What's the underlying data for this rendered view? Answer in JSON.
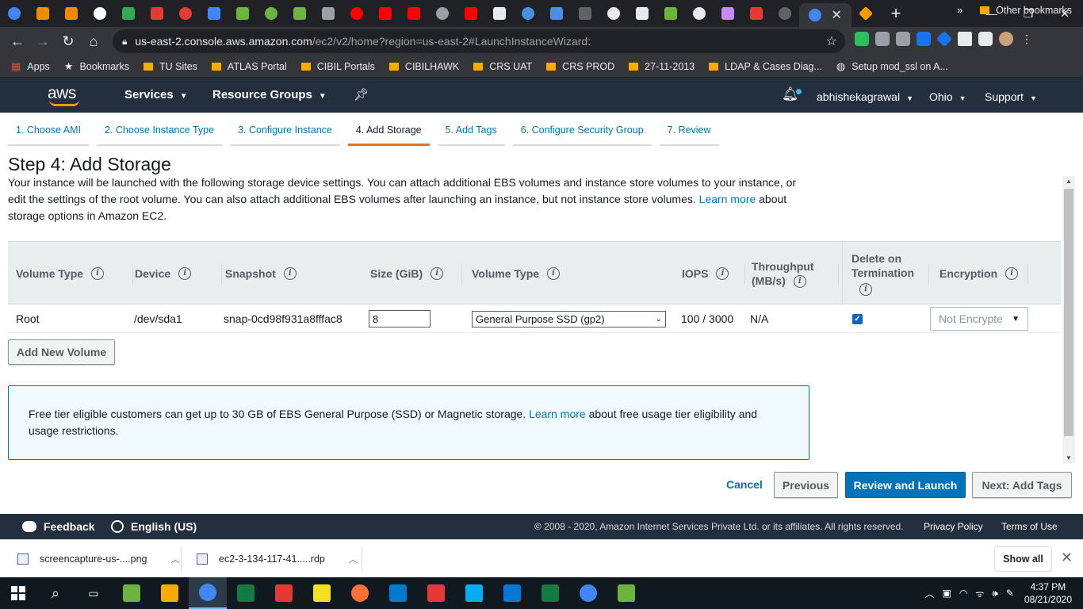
{
  "browser": {
    "url_host": "us-east-2.console.aws.amazon.com",
    "url_path": "/ec2/v2/home?region=us-east-2#LaunchInstanceWizard:",
    "tab_favicons": [
      "#4285f4",
      "#ef8b00",
      "#ef8b00",
      "#ffffff",
      "#34a853",
      "#e53935",
      "#e53935",
      "#4285f4",
      "#6db33f",
      "#6db33f",
      "#6db33f",
      "#9aa0a6",
      "#ff0000",
      "#ff0000",
      "#ff0000",
      "#9aa0a6",
      "#ff0000",
      "#e8eaed",
      "#4a90e2",
      "#4a90e2",
      "#5f6368",
      "#e8eaed",
      "#e8eaed",
      "#6db33f",
      "#e8eaed",
      "#c58af9",
      "#e53935",
      "#5f6368"
    ],
    "active_tab_close": "✕",
    "new_tab": "+",
    "bookmarks": [
      {
        "label": "Apps",
        "icon": "apps-grid-icon"
      },
      {
        "label": "Bookmarks",
        "icon": "star-icon"
      },
      {
        "label": "TU Sites",
        "icon": "folder-icon"
      },
      {
        "label": "ATLAS Portal",
        "icon": "folder-icon"
      },
      {
        "label": "CIBIL Portals",
        "icon": "folder-icon"
      },
      {
        "label": "CIBILHAWK",
        "icon": "folder-icon"
      },
      {
        "label": "CRS UAT",
        "icon": "folder-icon"
      },
      {
        "label": "CRS PROD",
        "icon": "folder-icon"
      },
      {
        "label": "27-11-2013",
        "icon": "folder-icon"
      },
      {
        "label": "LDAP & Cases Diag...",
        "icon": "folder-icon"
      },
      {
        "label": "Setup mod_ssl on A...",
        "icon": "globe-icon"
      }
    ],
    "overflow": "»",
    "other_bookmarks": "Other bookmarks"
  },
  "aws_nav": {
    "logo": "aws",
    "services": "Services",
    "resource_groups": "Resource Groups",
    "user": "abhishekagrawal",
    "region": "Ohio",
    "support": "Support"
  },
  "wizard": {
    "steps": [
      "1. Choose AMI",
      "2. Choose Instance Type",
      "3. Configure Instance",
      "4. Add Storage",
      "5. Add Tags",
      "6. Configure Security Group",
      "7. Review"
    ],
    "active_step": 3,
    "title": "Step 4: Add Storage",
    "desc_part1": "Your instance will be launched with the following storage device settings. You can attach additional EBS volumes and instance store volumes to your instance, or edit the settings of the root volume. You can also attach additional EBS volumes after launching an instance, but not instance store volumes.",
    "desc_link": "Learn more",
    "desc_part2": "about storage options in Amazon EC2."
  },
  "table": {
    "headers": {
      "volume_type": "Volume Type",
      "device": "Device",
      "snapshot": "Snapshot",
      "size": "Size (GiB)",
      "vol_type": "Volume Type",
      "iops": "IOPS",
      "throughput_1": "Throughput",
      "throughput_2": "(MB/s)",
      "delete_1": "Delete on",
      "delete_2": "Termination",
      "encryption": "Encryption"
    },
    "row": {
      "volume_type": "Root",
      "device": "/dev/sda1",
      "snapshot": "snap-0cd98f931a8fffac8",
      "size": "8",
      "vol_type": "General Purpose SSD (gp2)",
      "iops": "100 / 3000",
      "throughput": "N/A",
      "delete_on_termination": true,
      "encryption": "Not Encrypte"
    }
  },
  "add_volume": "Add New Volume",
  "free_tier": {
    "part1": "Free tier eligible customers can get up to 30 GB of EBS General Purpose (SSD) or Magnetic storage.",
    "link": "Learn more",
    "part2": "about free usage tier eligibility and usage restrictions."
  },
  "actions": {
    "cancel": "Cancel",
    "previous": "Previous",
    "review": "Review and Launch",
    "next": "Next: Add Tags"
  },
  "footer": {
    "feedback": "Feedback",
    "language": "English (US)",
    "copyright": "© 2008 - 2020, Amazon Internet Services Private Ltd. or its affiliates. All rights reserved.",
    "privacy": "Privacy Policy",
    "terms": "Terms of Use"
  },
  "downloads": {
    "items": [
      "screencapture-us-....png",
      "ec2-3-134-117-41.....rdp"
    ],
    "show_all": "Show all"
  },
  "taskbar": {
    "time": "4:37 PM",
    "date": "08/21/2020",
    "apps": [
      "#6db33f",
      "#f9ab00",
      "#4285f4",
      "#107c41",
      "#e53935",
      "#f7e01d",
      "#ff7139",
      "#007acc",
      "#e53935",
      "#00aff0",
      "#0078d4",
      "#107c41",
      "#4285f4",
      "#6db33f"
    ]
  },
  "colors": {
    "aws_nav": "#232f3e",
    "accent_orange": "#ec7211",
    "link_blue": "#0073bb",
    "primary_button": "#0073bb"
  }
}
